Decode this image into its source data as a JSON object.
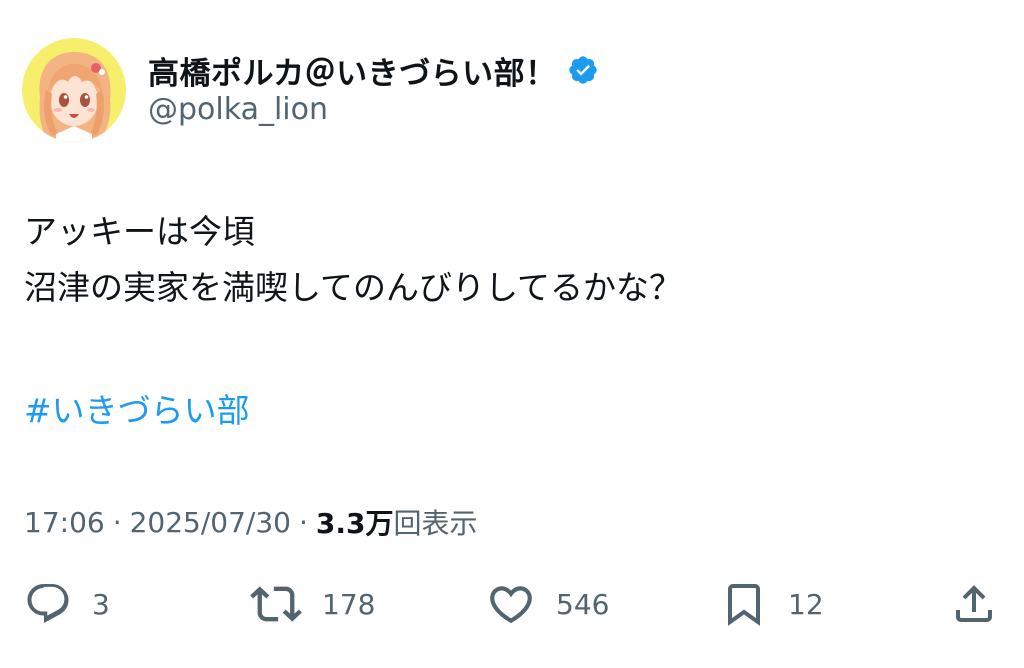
{
  "author": {
    "display_name": "高橋ポルカ＠いきづらい部！",
    "handle": "@polka_lion",
    "verified": true,
    "verified_color": "#1d9bf0",
    "avatar_icon": "anime-girl-avatar"
  },
  "tweet": {
    "lines": [
      "アッキーは今頃",
      "沼津の実家を満喫してのんびりしてるかな？"
    ],
    "hashtag": "#いきづらい部",
    "hashtag_color": "#1d9bf0"
  },
  "meta": {
    "time": "17:06",
    "separator": "·",
    "date": "2025/07/30",
    "views_count": "3.3万",
    "views_label": "回表示"
  },
  "actions": {
    "reply": {
      "icon": "reply-icon",
      "count": "3"
    },
    "retweet": {
      "icon": "retweet-icon",
      "count": "178"
    },
    "like": {
      "icon": "heart-icon",
      "count": "546"
    },
    "bookmark": {
      "icon": "bookmark-icon",
      "count": "12"
    },
    "share": {
      "icon": "share-icon"
    }
  }
}
